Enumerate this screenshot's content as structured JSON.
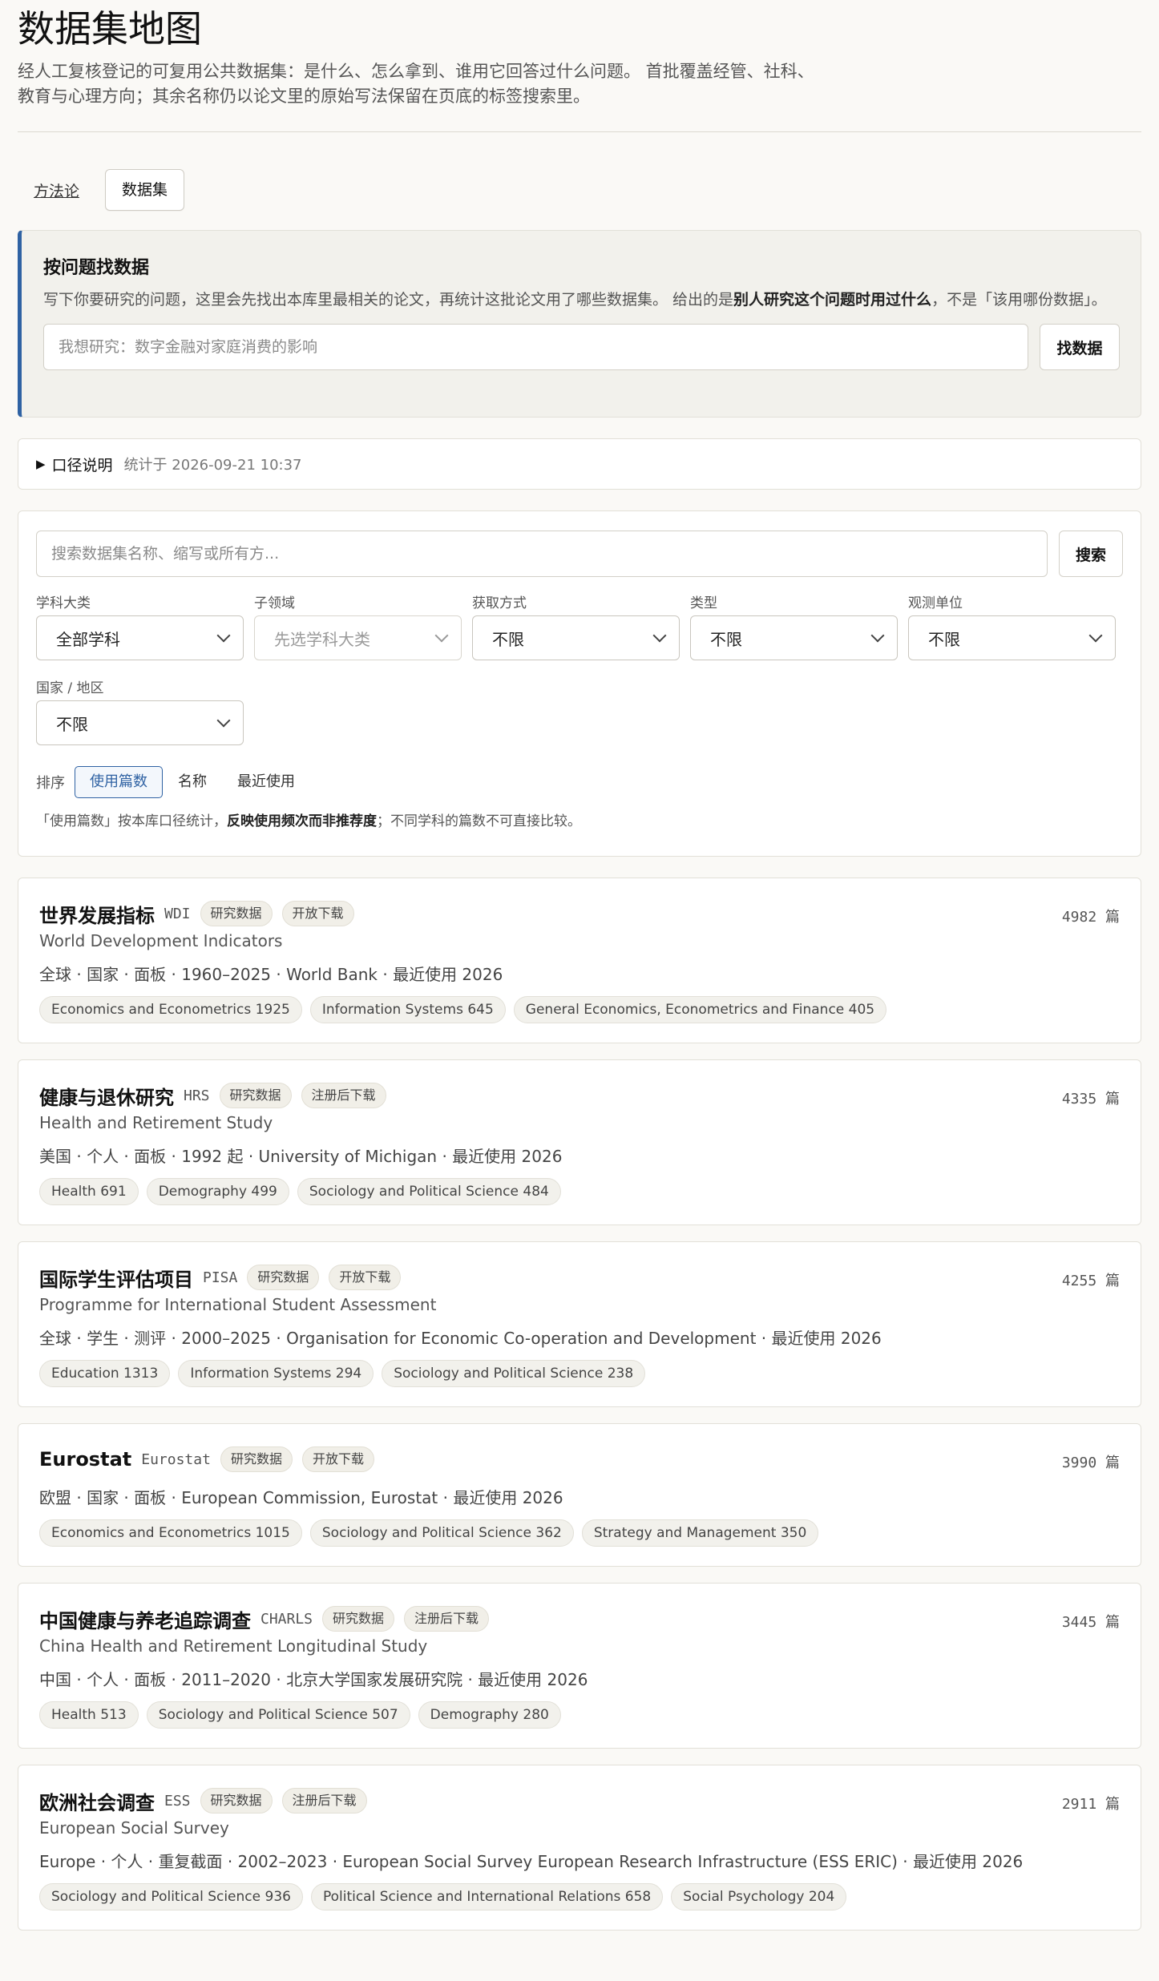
{
  "page": {
    "title": "数据集地图",
    "intro": "经人工复核登记的可复用公共数据集：是什么、怎么拿到、谁用它回答过什么问题。 首批覆盖经管、社科、教育与心理方向；其余名称仍以论文里的原始写法保留在页底的标签搜索里。"
  },
  "tabs": [
    {
      "label": "方法论"
    },
    {
      "label": "数据集"
    }
  ],
  "ask": {
    "title": "按问题找数据",
    "desc_pre": "写下你要研究的问题，这里会先找出本库里最相关的论文，再统计这批论文用了哪些数据集。 给出的是",
    "desc_bold": "别人研究这个问题时用过什么",
    "desc_post": "，不是「该用哪份数据」。",
    "placeholder": "我想研究：数字金融对家庭消费的影响",
    "button": "找数据"
  },
  "note": {
    "label": "口径说明",
    "time": "统计于 2026-09-21 10:37"
  },
  "search": {
    "placeholder": "搜索数据集名称、缩写或所有方...",
    "button": "搜索"
  },
  "filters": [
    {
      "label": "学科大类",
      "value": "全部学科"
    },
    {
      "label": "子领域",
      "value": "先选学科大类"
    },
    {
      "label": "获取方式",
      "value": "不限"
    },
    {
      "label": "类型",
      "value": "不限"
    },
    {
      "label": "观测单位",
      "value": "不限"
    },
    {
      "label": "国家 / 地区",
      "value": "不限"
    }
  ],
  "sort": {
    "label": "排序",
    "options": [
      "使用篇数",
      "名称",
      "最近使用"
    ],
    "active": "使用篇数",
    "note_pre": "「使用篇数」按本库口径统计，",
    "note_bold": "反映使用频次而非推荐度",
    "note_post": "；不同学科的篇数不可直接比较。"
  },
  "datasets": [
    {
      "name": "世界发展指标",
      "abbr": "WDI",
      "type": "研究数据",
      "access": "开放下载",
      "count": "4982 篇",
      "en": "World Development Indicators",
      "meta": "全球 · 国家 · 面板 · 1960–2025 · World Bank · 最近使用 2026",
      "tags": [
        "Economics and Econometrics 1925",
        "Information Systems 645",
        "General Economics, Econometrics and Finance 405"
      ]
    },
    {
      "name": "健康与退休研究",
      "abbr": "HRS",
      "type": "研究数据",
      "access": "注册后下载",
      "count": "4335 篇",
      "en": "Health and Retirement Study",
      "meta": "美国 · 个人 · 面板 · 1992 起 · University of Michigan · 最近使用 2026",
      "tags": [
        "Health 691",
        "Demography 499",
        "Sociology and Political Science 484"
      ]
    },
    {
      "name": "国际学生评估项目",
      "abbr": "PISA",
      "type": "研究数据",
      "access": "开放下载",
      "count": "4255 篇",
      "en": "Programme for International Student Assessment",
      "meta": "全球 · 学生 · 测评 · 2000–2025 · Organisation for Economic Co-operation and Development · 最近使用 2026",
      "tags": [
        "Education 1313",
        "Information Systems 294",
        "Sociology and Political Science 238"
      ]
    },
    {
      "name": "Eurostat",
      "abbr": "Eurostat",
      "type": "研究数据",
      "access": "开放下载",
      "count": "3990 篇",
      "en": "",
      "meta": "欧盟 · 国家 · 面板 · European Commission, Eurostat · 最近使用 2026",
      "tags": [
        "Economics and Econometrics 1015",
        "Sociology and Political Science 362",
        "Strategy and Management 350"
      ]
    },
    {
      "name": "中国健康与养老追踪调查",
      "abbr": "CHARLS",
      "type": "研究数据",
      "access": "注册后下载",
      "count": "3445 篇",
      "en": "China Health and Retirement Longitudinal Study",
      "meta": "中国 · 个人 · 面板 · 2011–2020 · 北京大学国家发展研究院 · 最近使用 2026",
      "tags": [
        "Health 513",
        "Sociology and Political Science 507",
        "Demography 280"
      ]
    },
    {
      "name": "欧洲社会调查",
      "abbr": "ESS",
      "type": "研究数据",
      "access": "注册后下载",
      "count": "2911 篇",
      "en": "European Social Survey",
      "meta": "Europe · 个人 · 重复截面 · 2002–2023 · European Social Survey European Research Infrastructure (ESS ERIC) · 最近使用 2026",
      "tags": [
        "Sociology and Political Science 936",
        "Political Science and International Relations 658",
        "Social Psychology 204"
      ]
    }
  ]
}
